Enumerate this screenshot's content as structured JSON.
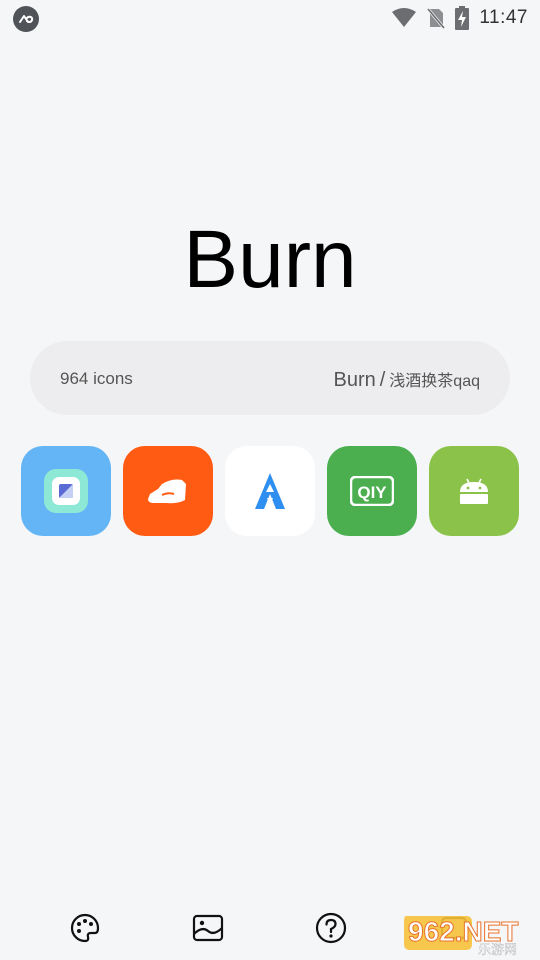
{
  "status_bar": {
    "time": "11:47",
    "icons": [
      "app-badge-icon",
      "wifi-icon",
      "no-sim-icon",
      "battery-charging-icon"
    ]
  },
  "app": {
    "title": "Burn"
  },
  "info_card": {
    "icon_count": "964 icons",
    "pack_name": "Burn",
    "separator": "/",
    "designer": "浅酒换茶qaq"
  },
  "preview_icons": [
    {
      "name": "square-app-icon",
      "background": "#63b5f6"
    },
    {
      "name": "orange-hand-app-icon",
      "background": "#ff5b13"
    },
    {
      "name": "rocket-a-app-icon",
      "background": "#ffffff"
    },
    {
      "name": "iqiyi-app-icon",
      "background": "#4bae4f"
    },
    {
      "name": "android-app-icon",
      "background": "#8bc34a"
    }
  ],
  "iqiyi_label": "QIY",
  "bottom_nav": [
    "palette-icon",
    "wallpaper-icon",
    "help-icon",
    "apply-icon"
  ],
  "watermark": {
    "big": "962.NET",
    "small": "乐游网"
  }
}
